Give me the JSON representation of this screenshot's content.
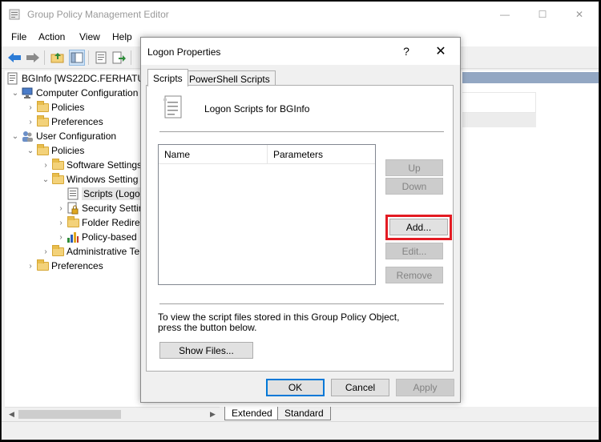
{
  "window": {
    "title": "Group Policy Management Editor",
    "minimize_glyph": "—",
    "maximize_glyph": "☐",
    "close_glyph": "✕"
  },
  "menu": [
    "File",
    "Action",
    "View",
    "Help"
  ],
  "tree": {
    "root": "BGInfo [WS22DC.FERHATUL",
    "items": [
      {
        "label": "Computer Configuration",
        "level": 0
      },
      {
        "label": "Policies",
        "level": 1
      },
      {
        "label": "Preferences",
        "level": 1
      },
      {
        "label": "User Configuration",
        "level": 0
      },
      {
        "label": "Policies",
        "level": 1
      },
      {
        "label": "Software Settings",
        "level": 2
      },
      {
        "label": "Windows Setting",
        "level": 2
      },
      {
        "label": "Scripts (Logo",
        "level": 3
      },
      {
        "label": "Security Settir",
        "level": 3
      },
      {
        "label": "Folder Redire",
        "level": 3
      },
      {
        "label": "Policy-based",
        "level": 3
      },
      {
        "label": "Administrative Te",
        "level": 2
      },
      {
        "label": "Preferences",
        "level": 1
      }
    ]
  },
  "bottom_tabs": [
    "Extended",
    "Standard"
  ],
  "dialog": {
    "title": "Logon Properties",
    "help_glyph": "?",
    "close_glyph": "✕",
    "tabs": [
      "Scripts",
      "PowerShell Scripts"
    ],
    "heading": "Logon Scripts for BGInfo",
    "columns": [
      "Name",
      "Parameters"
    ],
    "buttons": {
      "up": "Up",
      "down": "Down",
      "add": "Add...",
      "edit": "Edit...",
      "remove": "Remove",
      "show_files": "Show Files...",
      "ok": "OK",
      "cancel": "Cancel",
      "apply": "Apply"
    },
    "info_text": "To view the script files stored in this Group Policy Object, press the button below."
  },
  "colors": {
    "accent": "#0078d7",
    "highlight": "#e31b23",
    "selected_strip": "#93a7c3"
  }
}
